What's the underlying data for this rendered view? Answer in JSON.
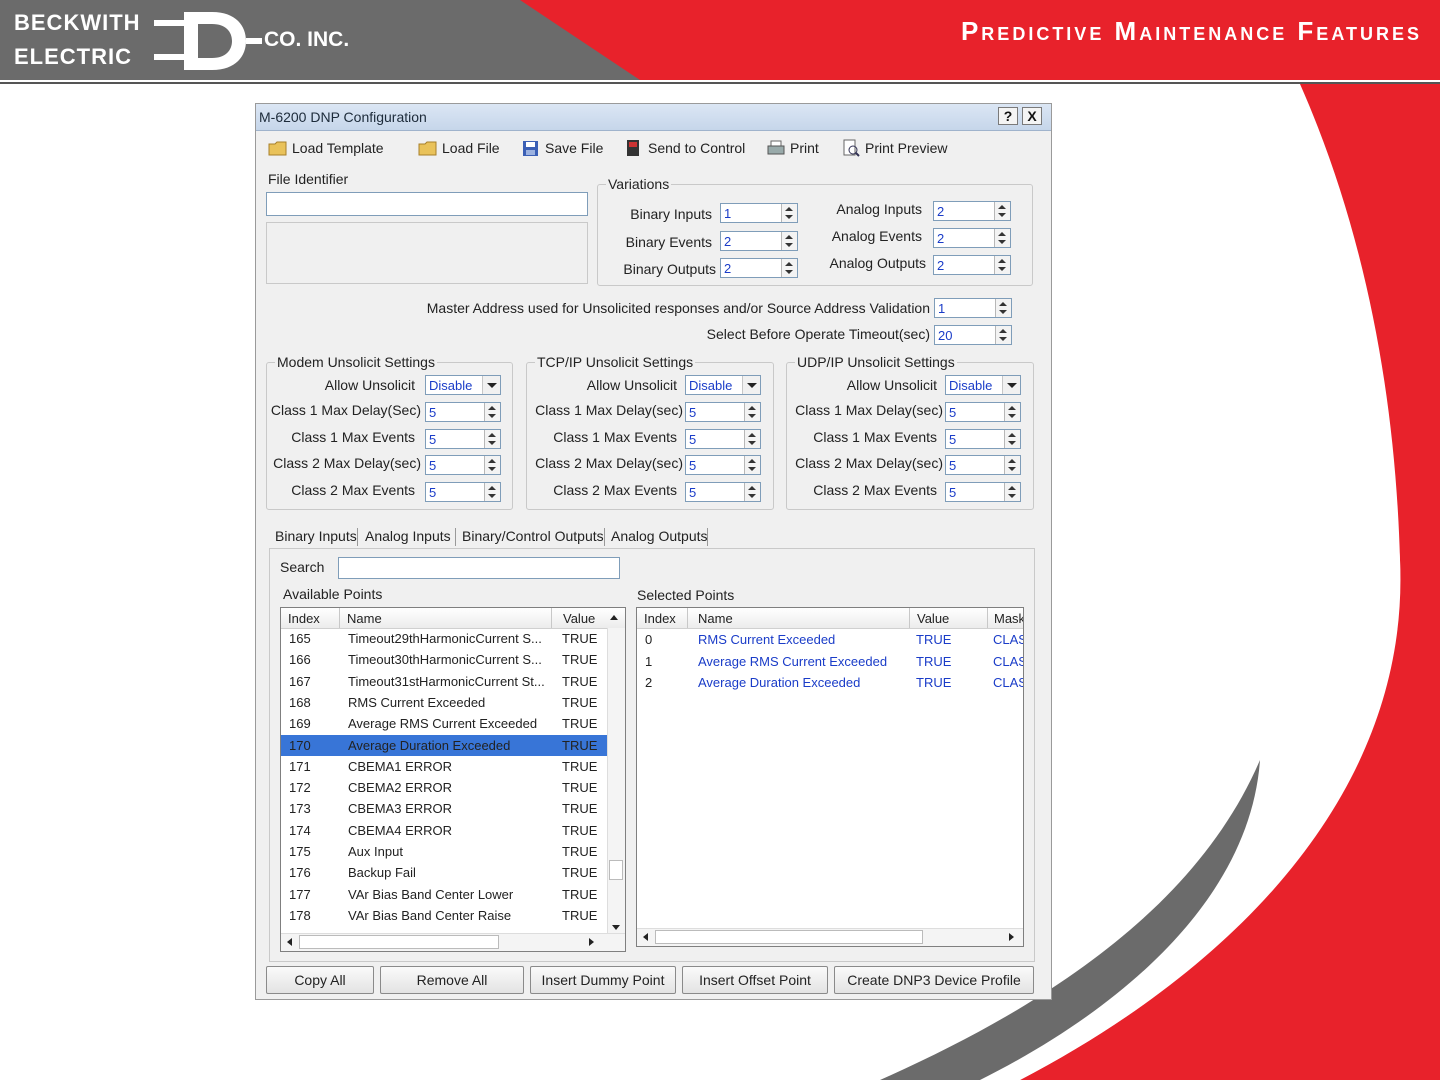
{
  "brand": {
    "line1": "BECKWITH",
    "line2": "ELECTRIC",
    "suffix": "CO. INC.",
    "red": "#e8222b",
    "gray": "#6b6b6b"
  },
  "slide_title": "Predictive Maintenance Features",
  "window": {
    "title": "M-6200 DNP Configuration",
    "help_label": "?",
    "close_label": "X",
    "titlebar_color": "#c6d6ea"
  },
  "toolbar": {
    "load_template": "Load Template",
    "load_file": "Load File",
    "save_file": "Save File",
    "send_to_control": "Send to Control",
    "print": "Print",
    "print_preview": "Print Preview"
  },
  "file_identifier": {
    "label": "File Identifier",
    "value": ""
  },
  "variations": {
    "title": "Variations",
    "binary_inputs_label": "Binary Inputs",
    "binary_inputs": "1",
    "binary_events_label": "Binary Events",
    "binary_events": "2",
    "binary_outputs_label": "Binary Outputs",
    "binary_outputs": "2",
    "analog_inputs_label": "Analog Inputs",
    "analog_inputs": "2",
    "analog_events_label": "Analog Events",
    "analog_events": "2",
    "analog_outputs_label": "Analog Outputs",
    "analog_outputs": "2"
  },
  "master_address": {
    "label": "Master Address used for Unsolicited responses and/or Source Address Validation",
    "value": "1"
  },
  "sbo_timeout": {
    "label": "Select Before Operate Timeout(sec)",
    "value": "20"
  },
  "modem": {
    "title": "Modem Unsolicit Settings",
    "allow_label": "Allow Unsolicit",
    "allow_value": "Disable",
    "c1_delay_label": "Class 1 Max Delay(Sec)",
    "c1_delay": "5",
    "c1_events_label": "Class 1 Max Events",
    "c1_events": "5",
    "c2_delay_label": "Class 2 Max Delay(sec)",
    "c2_delay": "5",
    "c2_events_label": "Class 2 Max Events",
    "c2_events": "5"
  },
  "tcpip": {
    "title": "TCP/IP Unsolicit Settings",
    "allow_label": "Allow Unsolicit",
    "allow_value": "Disable",
    "c1_delay_label": "Class 1 Max Delay(sec)",
    "c1_delay": "5",
    "c1_events_label": "Class 1 Max Events",
    "c1_events": "5",
    "c2_delay_label": "Class 2 Max Delay(sec)",
    "c2_delay": "5",
    "c2_events_label": "Class 2 Max Events",
    "c2_events": "5"
  },
  "udpip": {
    "title": "UDP/IP Unsolicit Settings",
    "allow_label": "Allow Unsolicit",
    "allow_value": "Disable",
    "c1_delay_label": "Class 1 Max Delay(sec)",
    "c1_delay": "5",
    "c1_events_label": "Class 1 Max Events",
    "c1_events": "5",
    "c2_delay_label": "Class 2 Max Delay(sec)",
    "c2_delay": "5",
    "c2_events_label": "Class 2 Max Events",
    "c2_events": "5"
  },
  "tabs": [
    "Binary Inputs",
    "Analog Inputs",
    "Binary/Control Outputs",
    "Analog Outputs"
  ],
  "search": {
    "label": "Search",
    "value": ""
  },
  "available": {
    "label": "Available Points",
    "headers": [
      "Index",
      "Name",
      "Value"
    ],
    "rows": [
      [
        "165",
        "Timeout29thHarmonicCurrent S...",
        "TRUE"
      ],
      [
        "166",
        "Timeout30thHarmonicCurrent S...",
        "TRUE"
      ],
      [
        "167",
        "Timeout31stHarmonicCurrent St...",
        "TRUE"
      ],
      [
        "168",
        "RMS Current Exceeded",
        "TRUE"
      ],
      [
        "169",
        "Average RMS Current Exceeded",
        "TRUE"
      ],
      [
        "170",
        "Average Duration Exceeded",
        "TRUE"
      ],
      [
        "171",
        "CBEMA1 ERROR",
        "TRUE"
      ],
      [
        "172",
        "CBEMA2 ERROR",
        "TRUE"
      ],
      [
        "173",
        "CBEMA3 ERROR",
        "TRUE"
      ],
      [
        "174",
        "CBEMA4 ERROR",
        "TRUE"
      ],
      [
        "175",
        "Aux Input",
        "TRUE"
      ],
      [
        "176",
        "Backup Fail",
        "TRUE"
      ],
      [
        "177",
        "VAr Bias Band Center Lower",
        "TRUE"
      ],
      [
        "178",
        "VAr Bias Band Center Raise",
        "TRUE"
      ]
    ],
    "selected_index": "170"
  },
  "selected": {
    "label": "Selected Points",
    "headers": [
      "Index",
      "Name",
      "Value",
      "Mask"
    ],
    "rows": [
      [
        "0",
        "RMS Current Exceeded",
        "TRUE",
        "CLAS"
      ],
      [
        "1",
        "Average RMS Current Exceeded",
        "TRUE",
        "CLAS"
      ],
      [
        "2",
        "Average Duration Exceeded",
        "TRUE",
        "CLAS"
      ]
    ]
  },
  "buttons": {
    "copy_all": "Copy All",
    "remove_all": "Remove All",
    "insert_dummy": "Insert Dummy Point",
    "insert_offset": "Insert Offset Point",
    "create_profile": "Create DNP3 Device Profile"
  }
}
